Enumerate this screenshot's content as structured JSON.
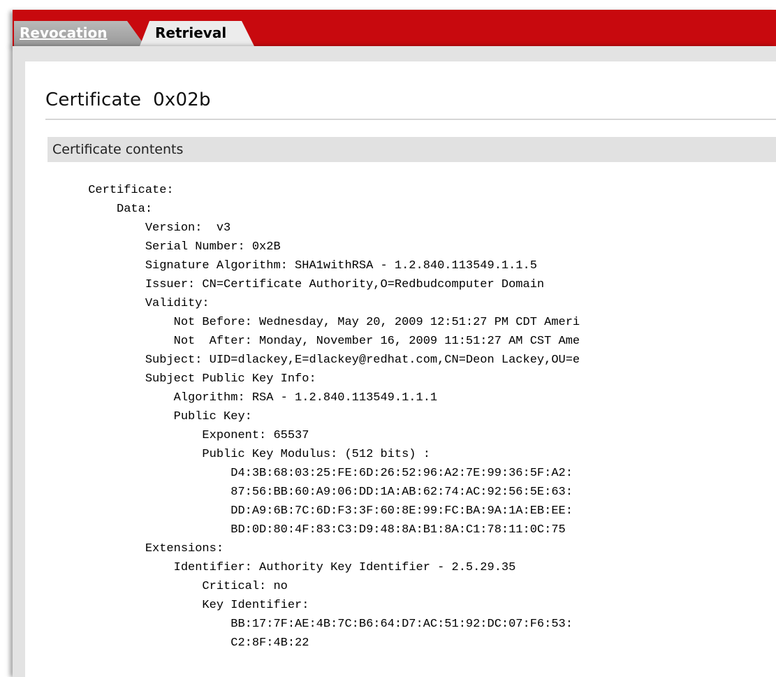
{
  "tabs": [
    {
      "label": "Revocation",
      "active": false
    },
    {
      "label": "Retrieval",
      "active": true
    }
  ],
  "page": {
    "title": "Certificate  0x02b"
  },
  "section": {
    "header": "Certificate contents"
  },
  "certificate_lines": [
    "      Certificate:",
    "          Data:",
    "              Version:  v3",
    "              Serial Number: 0x2B",
    "              Signature Algorithm: SHA1withRSA - 1.2.840.113549.1.1.5",
    "              Issuer: CN=Certificate Authority,O=Redbudcomputer Domain",
    "              Validity:",
    "                  Not Before: Wednesday, May 20, 2009 12:51:27 PM CDT Ameri",
    "                  Not  After: Monday, November 16, 2009 11:51:27 AM CST Ame",
    "              Subject: UID=dlackey,E=dlackey@redhat.com,CN=Deon Lackey,OU=e",
    "              Subject Public Key Info:",
    "                  Algorithm: RSA - 1.2.840.113549.1.1.1",
    "                  Public Key:",
    "                      Exponent: 65537",
    "                      Public Key Modulus: (512 bits) :",
    "                          D4:3B:68:03:25:FE:6D:26:52:96:A2:7E:99:36:5F:A2:",
    "                          87:56:BB:60:A9:06:DD:1A:AB:62:74:AC:92:56:5E:63:",
    "                          DD:A9:6B:7C:6D:F3:3F:60:8E:99:FC:BA:9A:1A:EB:EE:",
    "                          BD:0D:80:4F:83:C3:D9:48:8A:B1:8A:C1:78:11:0C:75",
    "              Extensions:",
    "                  Identifier: Authority Key Identifier - 2.5.29.35",
    "                      Critical: no",
    "                      Key Identifier:",
    "                          BB:17:7F:AE:4B:7C:B6:64:D7:AC:51:92:DC:07:F6:53:",
    "                          C2:8F:4B:22"
  ],
  "colors": {
    "tab_bar": "#c8090e",
    "frame": "#e3e3e3",
    "section_header_bg": "#e1e1e1"
  }
}
